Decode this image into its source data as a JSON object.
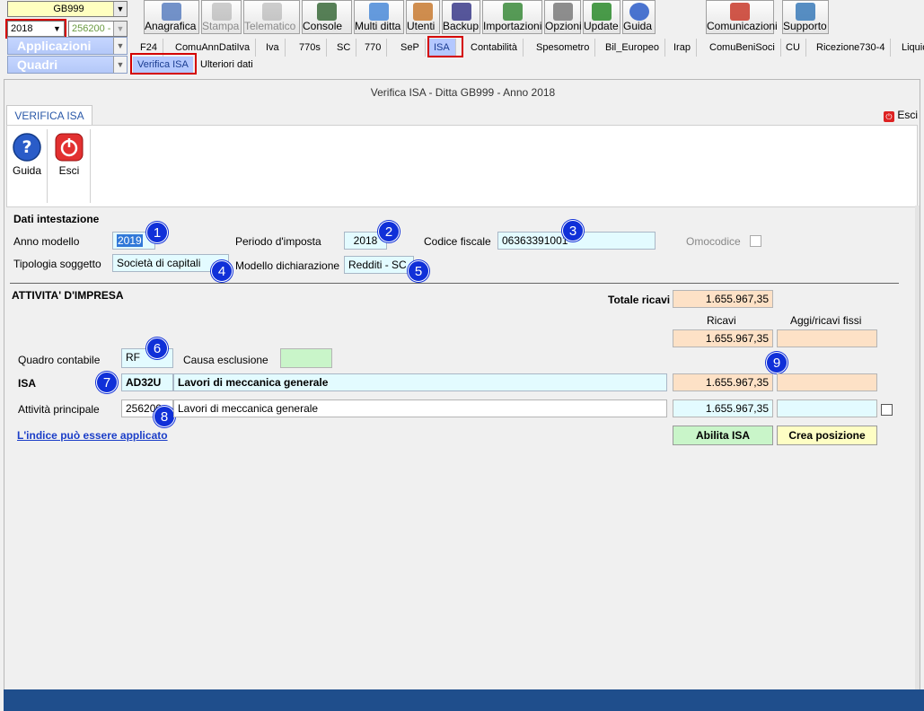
{
  "top_left": {
    "company_code": "GB999",
    "year": "2018",
    "code": "256200 -",
    "applicazioni_label": "Applicazioni",
    "quadri_label": "Quadri"
  },
  "toolbar": {
    "buttons": [
      {
        "label": "Anagrafica",
        "icon": "anagrafica-icon"
      },
      {
        "label": "Stampa",
        "icon": "print-icon"
      },
      {
        "label": "Telematico",
        "icon": "telematico-icon"
      },
      {
        "label": "Console",
        "icon": "console-icon"
      },
      {
        "label": "Multi ditta",
        "icon": "multi-ditta-icon"
      },
      {
        "label": "Utenti",
        "icon": "users-icon"
      },
      {
        "label": "Backup",
        "icon": "backup-icon"
      },
      {
        "label": "Importazioni",
        "icon": "import-icon"
      },
      {
        "label": "Opzioni",
        "icon": "options-icon"
      },
      {
        "label": "Update",
        "icon": "update-icon"
      },
      {
        "label": "Guida",
        "icon": "help-icon"
      },
      {
        "label": "Comunicazioni",
        "icon": "comunicazioni-icon"
      },
      {
        "label": "Supporto",
        "icon": "support-icon"
      }
    ]
  },
  "module_tabs": [
    "F24",
    "ComuAnnDatiIva",
    "Iva",
    "770s",
    "SC",
    "770",
    "SeP",
    "ISA",
    "Contabilità",
    "Spesometro",
    "Bil_Europeo",
    "Irap",
    "ComuBeniSoci",
    "CU",
    "Ricezione730-4",
    "Liquid"
  ],
  "sub_tabs": [
    "Verifica ISA",
    "Ulteriori dati"
  ],
  "window": {
    "title": "Verifica ISA - Ditta GB999 - Anno 2018",
    "tab_label": "VERIFICA ISA",
    "exit_link": "Esci",
    "guida_label": "Guida",
    "esci_label": "Esci"
  },
  "dati_intestazione": {
    "heading": "Dati intestazione",
    "anno_modello_label": "Anno modello",
    "anno_modello": "2019",
    "periodo_label": "Periodo d'imposta",
    "periodo": "2018",
    "codice_fiscale_label": "Codice fiscale",
    "codice_fiscale": "06363391001",
    "omocodice_label": "Omocodice",
    "tipologia_label": "Tipologia soggetto",
    "tipologia": "Società di capitali",
    "modello_label": "Modello dichiarazione",
    "modello": "Redditi - SC"
  },
  "attivita": {
    "heading": "ATTIVITA' D'IMPRESA",
    "totale_ricavi_label": "Totale ricavi",
    "totale_ricavi": "1.655.967,35",
    "ricavi_col": "Ricavi",
    "aggi_col": "Aggi/ricavi fissi",
    "ricavi_row1": "1.655.967,35",
    "quadro_label": "Quadro contabile",
    "quadro": "RF",
    "causa_label": "Causa esclusione",
    "isa_label": "ISA",
    "isa_code": "AD32U",
    "isa_desc": "Lavori di meccanica generale",
    "isa_ricavi": "1.655.967,35",
    "attivita_label": "Attività principale",
    "attivita_code": "256200",
    "attivita_desc": "Lavori di meccanica generale",
    "attivita_ricavi": "1.655.967,35",
    "link": "L'indice può essere applicato",
    "abilita_btn": "Abilita ISA",
    "crea_btn": "Crea posizione"
  },
  "badges": [
    "1",
    "2",
    "3",
    "4",
    "5",
    "6",
    "7",
    "8",
    "9"
  ]
}
